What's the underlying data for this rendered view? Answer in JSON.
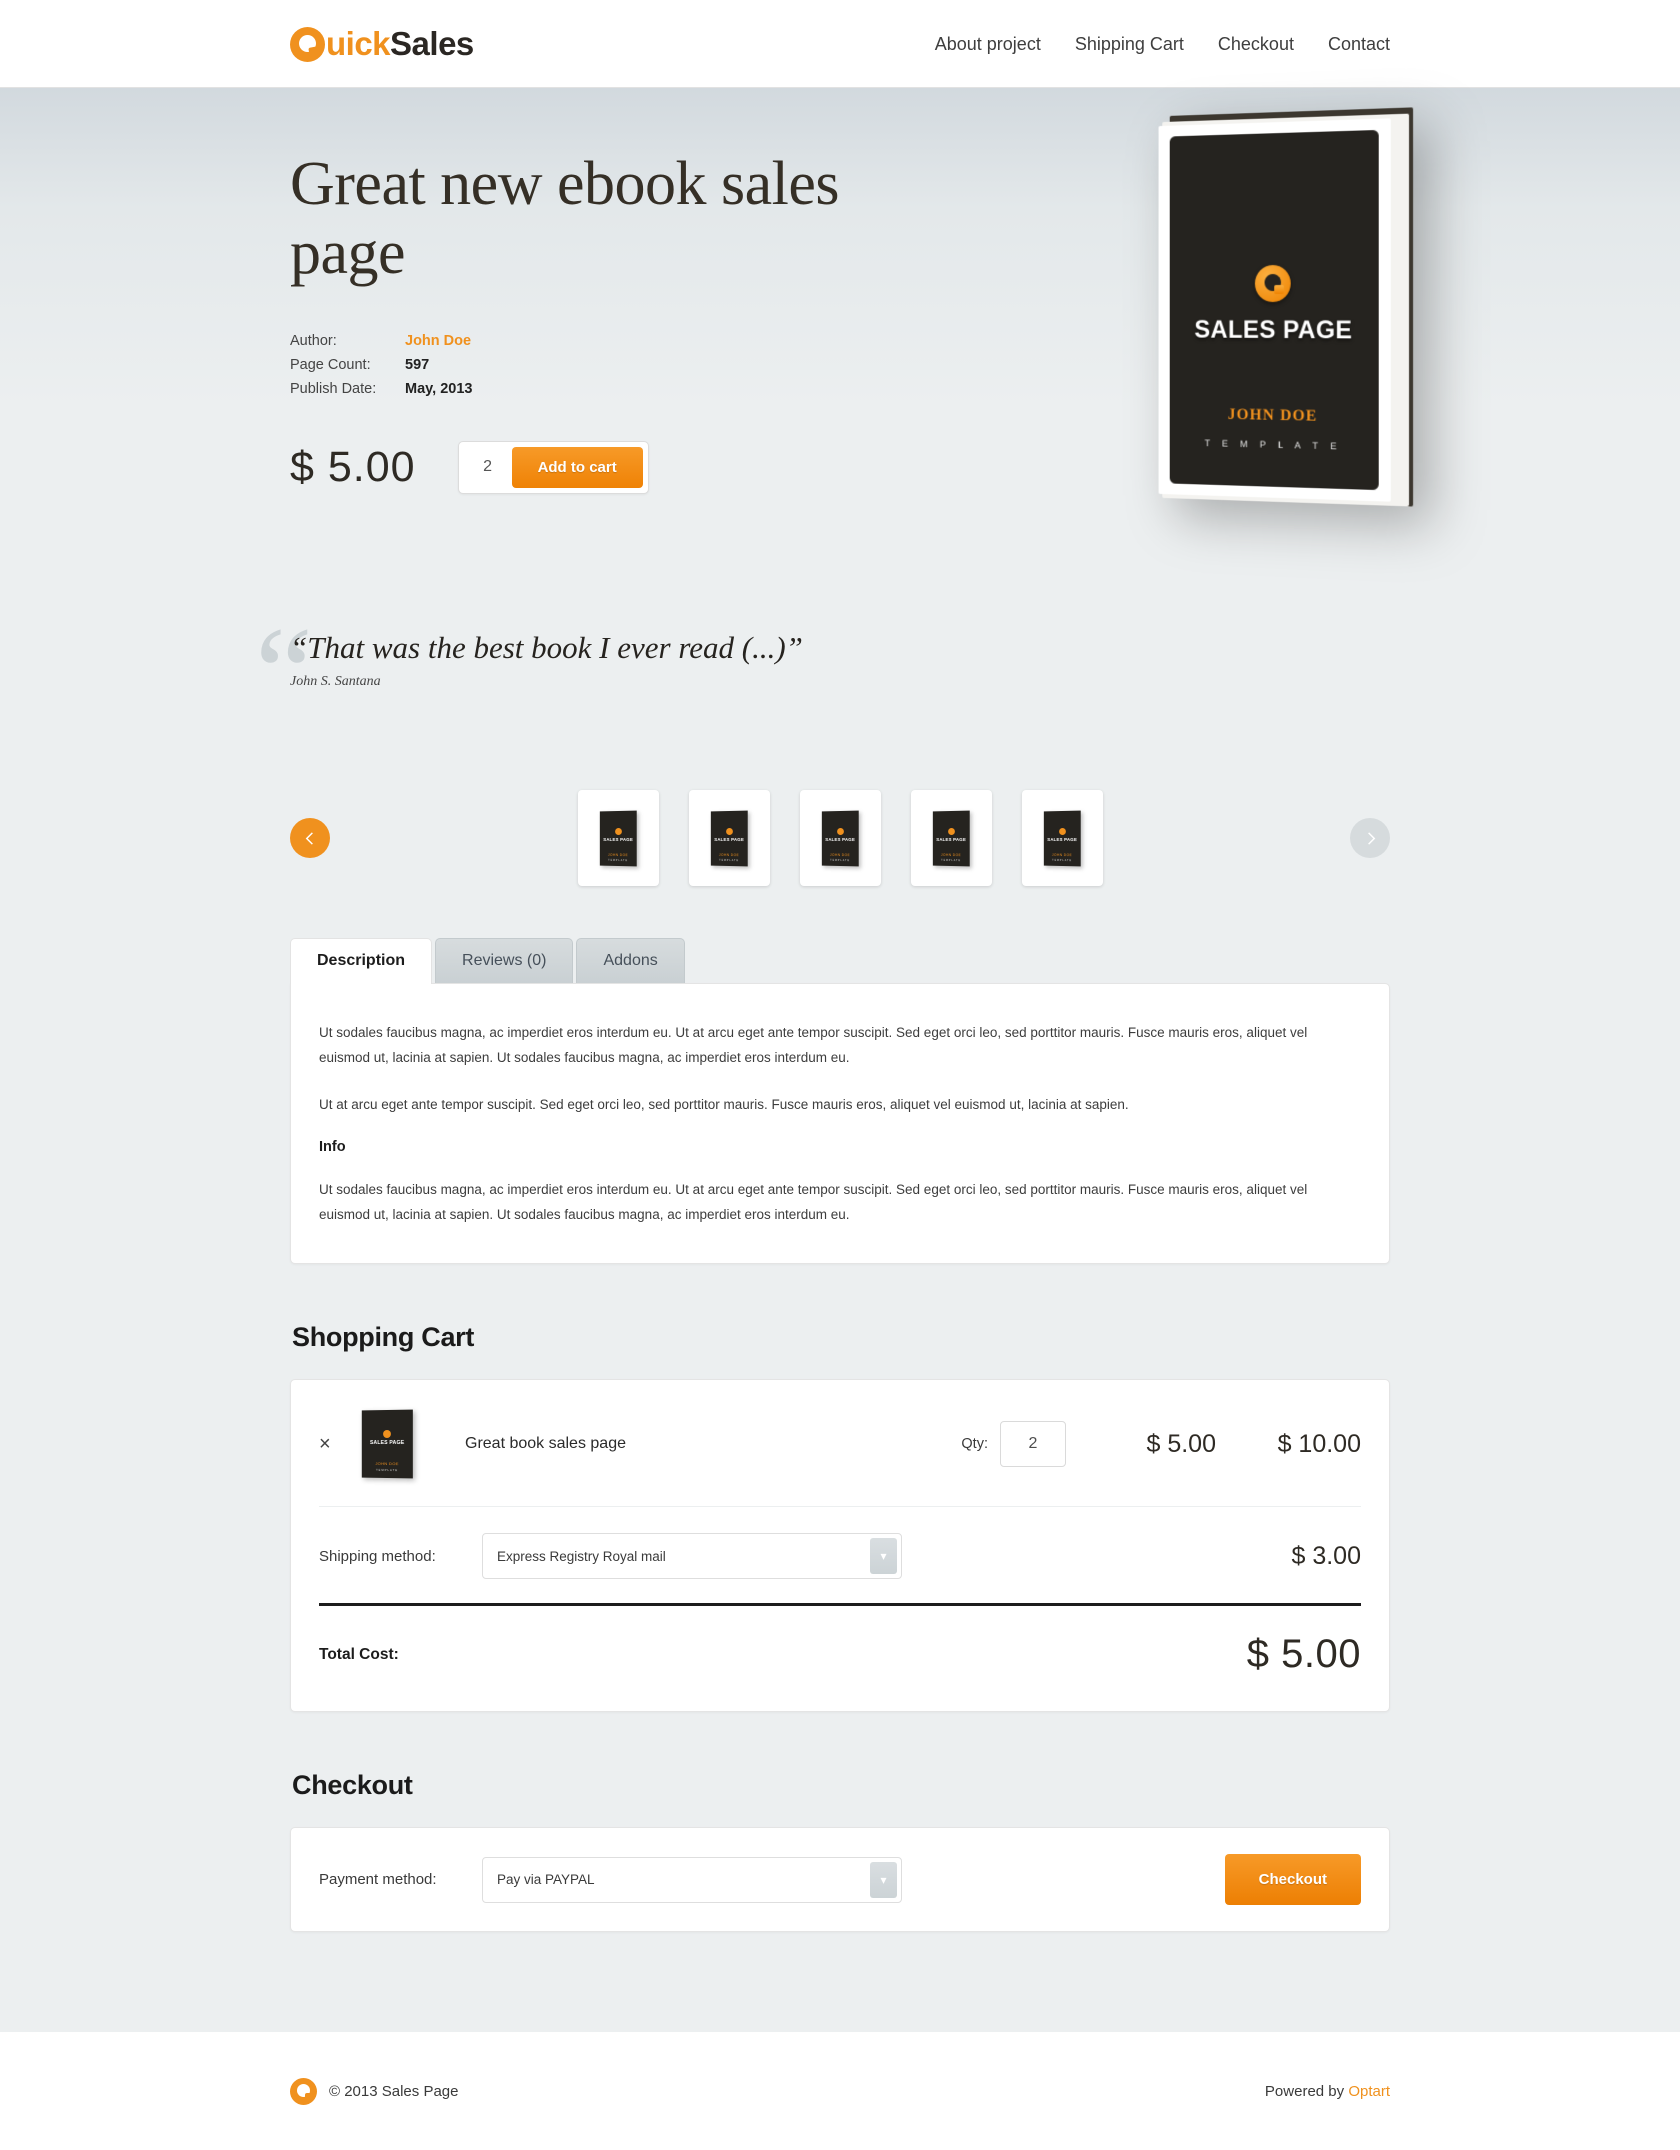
{
  "header": {
    "logo": {
      "mark": "q-circle-icon",
      "text_a": "uick",
      "text_b": "Sales"
    },
    "nav": [
      {
        "label": "About project"
      },
      {
        "label": "Shipping Cart"
      },
      {
        "label": "Checkout"
      },
      {
        "label": "Contact"
      }
    ]
  },
  "hero": {
    "title": "Great new ebook sales page",
    "meta": [
      {
        "label": "Author:",
        "value": "John Doe",
        "accent": true
      },
      {
        "label": "Page Count:",
        "value": "597",
        "accent": false
      },
      {
        "label": "Publish Date:",
        "value": "May, 2013",
        "accent": false
      }
    ],
    "price": "$ 5.00",
    "quantity": "2",
    "add_to_cart_label": "Add to cart",
    "book": {
      "title": "SALES PAGE",
      "author": "JOHN DOE",
      "subtitle": "T E M P L A T E"
    }
  },
  "quote": {
    "mark": "“",
    "text": "“That was the best book I ever read (...)”",
    "author": "John S. Santana"
  },
  "carousel": {
    "prev_icon": "chevron-left-icon",
    "next_icon": "chevron-right-icon",
    "thumbs": [
      {
        "title": "SALES PAGE",
        "author": "JOHN DOE",
        "sub": "TEMPLATE"
      },
      {
        "title": "SALES PAGE",
        "author": "JOHN DOE",
        "sub": "TEMPLATE"
      },
      {
        "title": "SALES PAGE",
        "author": "JOHN DOE",
        "sub": "TEMPLATE"
      },
      {
        "title": "SALES PAGE",
        "author": "JOHN DOE",
        "sub": "TEMPLATE"
      },
      {
        "title": "SALES PAGE",
        "author": "JOHN DOE",
        "sub": "TEMPLATE"
      }
    ]
  },
  "tabs": [
    {
      "label": "Description",
      "active": true
    },
    {
      "label": "Reviews (0)",
      "active": false
    },
    {
      "label": "Addons",
      "active": false
    }
  ],
  "description": {
    "p1": "Ut sodales faucibus magna, ac imperdiet eros interdum eu. Ut at arcu eget ante tempor suscipit. Sed eget orci leo, sed porttitor mauris. Fusce mauris eros, aliquet vel euismod ut, lacinia at sapien. Ut sodales faucibus magna, ac imperdiet eros interdum eu.",
    "p2": "Ut at arcu eget ante tempor suscipit. Sed eget orci leo, sed porttitor mauris. Fusce mauris eros, aliquet vel euismod ut, lacinia at sapien.",
    "info_heading": "Info",
    "p3": "Ut sodales faucibus magna, ac imperdiet eros interdum eu. Ut at arcu eget ante tempor suscipit. Sed eget orci leo, sed porttitor mauris. Fusce mauris eros, aliquet vel euismod ut, lacinia at sapien. Ut sodales faucibus magna, ac imperdiet eros interdum eu."
  },
  "cart": {
    "section_title": "Shopping Cart",
    "item": {
      "remove_icon": "×",
      "name": "Great book sales page",
      "qty_label": "Qty:",
      "qty": "2",
      "unit_price": "$ 5.00",
      "line_total": "$ 10.00",
      "thumb": {
        "title": "SALES PAGE",
        "author": "JOHN DOE",
        "sub": "TEMPLATE"
      }
    },
    "shipping": {
      "label": "Shipping method:",
      "selected": "Express Registry Royal mail",
      "price": "$ 3.00"
    },
    "total": {
      "label": "Total Cost:",
      "value": "$ 5.00"
    }
  },
  "checkout": {
    "section_title": "Checkout",
    "payment_label": "Payment method:",
    "payment_selected": "Pay via PAYPAL",
    "button_label": "Checkout"
  },
  "footer": {
    "copyright": "© 2013 Sales Page",
    "powered_prefix": "Powered by ",
    "powered_link": "Optart"
  },
  "colors": {
    "accent": "#f0911e",
    "accent_dark": "#ed7f03",
    "page_bg": "#eceff0",
    "bg_top": "#d2d9de",
    "dark": "#25231f"
  }
}
